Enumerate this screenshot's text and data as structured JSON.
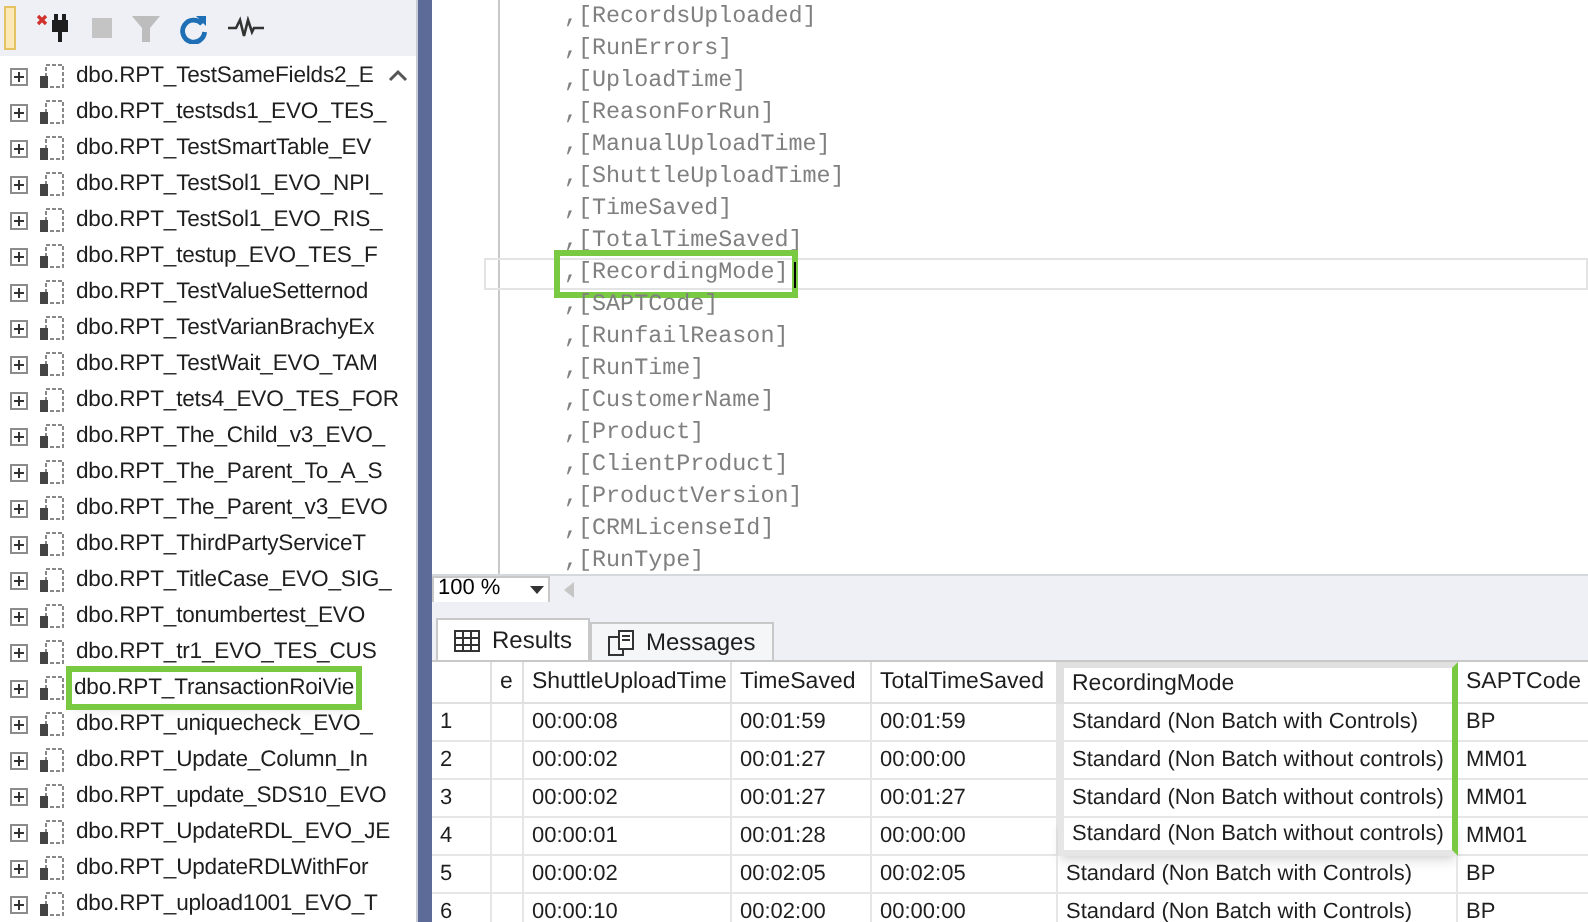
{
  "tree": {
    "items": [
      {
        "label": "dbo.RPT_TestSameFields2_E",
        "highlighted": false
      },
      {
        "label": "dbo.RPT_testsds1_EVO_TES_",
        "highlighted": false
      },
      {
        "label": "dbo.RPT_TestSmartTable_EV",
        "highlighted": false
      },
      {
        "label": "dbo.RPT_TestSol1_EVO_NPI_",
        "highlighted": false
      },
      {
        "label": "dbo.RPT_TestSol1_EVO_RIS_",
        "highlighted": false
      },
      {
        "label": "dbo.RPT_testup_EVO_TES_F",
        "highlighted": false
      },
      {
        "label": "dbo.RPT_TestValueSetternod",
        "highlighted": false
      },
      {
        "label": "dbo.RPT_TestVarianBrachyEx",
        "highlighted": false
      },
      {
        "label": "dbo.RPT_TestWait_EVO_TAM",
        "highlighted": false
      },
      {
        "label": "dbo.RPT_tets4_EVO_TES_FOR",
        "highlighted": false
      },
      {
        "label": "dbo.RPT_The_Child_v3_EVO_",
        "highlighted": false
      },
      {
        "label": "dbo.RPT_The_Parent_To_A_S",
        "highlighted": false
      },
      {
        "label": "dbo.RPT_The_Parent_v3_EVO",
        "highlighted": false
      },
      {
        "label": "dbo.RPT_ThirdPartyServiceT",
        "highlighted": false
      },
      {
        "label": "dbo.RPT_TitleCase_EVO_SIG_",
        "highlighted": false
      },
      {
        "label": "dbo.RPT_tonumbertest_EVO",
        "highlighted": false
      },
      {
        "label": "dbo.RPT_tr1_EVO_TES_CUS",
        "highlighted": false
      },
      {
        "label": "dbo.RPT_TransactionRoiVie",
        "highlighted": true
      },
      {
        "label": "dbo.RPT_uniquecheck_EVO_",
        "highlighted": false
      },
      {
        "label": "dbo.RPT_Update_Column_In",
        "highlighted": false
      },
      {
        "label": "dbo.RPT_update_SDS10_EVO",
        "highlighted": false
      },
      {
        "label": "dbo.RPT_UpdateRDL_EVO_JE",
        "highlighted": false
      },
      {
        "label": "dbo.RPT_UpdateRDLWithFor",
        "highlighted": false
      },
      {
        "label": "dbo.RPT_upload1001_EVO_T",
        "highlighted": false
      }
    ]
  },
  "editor": {
    "lines": [
      {
        "text": ",[RecordsUploaded]",
        "current": false
      },
      {
        "text": ",[RunErrors]",
        "current": false
      },
      {
        "text": ",[UploadTime]",
        "current": false
      },
      {
        "text": ",[ReasonForRun]",
        "current": false
      },
      {
        "text": ",[ManualUploadTime]",
        "current": false
      },
      {
        "text": ",[ShuttleUploadTime]",
        "current": false
      },
      {
        "text": ",[TimeSaved]",
        "current": false
      },
      {
        "text": ",[TotalTimeSaved]",
        "current": false
      },
      {
        "text": ",[RecordingMode]",
        "current": true
      },
      {
        "text": ",[SAPTCode]",
        "current": false
      },
      {
        "text": ",[RunfailReason]",
        "current": false
      },
      {
        "text": ",[RunTime]",
        "current": false
      },
      {
        "text": ",[CustomerName]",
        "current": false
      },
      {
        "text": ",[Product]",
        "current": false
      },
      {
        "text": ",[ClientProduct]",
        "current": false
      },
      {
        "text": ",[ProductVersion]",
        "current": false
      },
      {
        "text": ",[CRMLicenseId]",
        "current": false
      },
      {
        "text": ",[RunType]",
        "current": false
      }
    ],
    "zoom": "100 %"
  },
  "tabs": [
    {
      "label": "Results",
      "selected": true
    },
    {
      "label": "Messages",
      "selected": false
    }
  ],
  "grid": {
    "columns": [
      {
        "highlighted": false
      },
      {
        "label": "e",
        "highlighted": false
      },
      {
        "label": "ShuttleUploadTime",
        "highlighted": false
      },
      {
        "label": "TimeSaved",
        "highlighted": false
      },
      {
        "label": "TotalTimeSaved",
        "highlighted": false
      },
      {
        "label": "RecordingMode",
        "highlighted": true
      },
      {
        "label": "SAPTCode",
        "highlighted": false
      }
    ],
    "rows": [
      [
        "1",
        "",
        "00:00:08",
        "00:01:59",
        "00:01:59",
        "Standard (Non Batch with Controls)",
        "BP"
      ],
      [
        "2",
        "",
        "00:00:02",
        "00:01:27",
        "00:00:00",
        "Standard (Non Batch without controls)",
        "MM01"
      ],
      [
        "3",
        "",
        "00:00:02",
        "00:01:27",
        "00:01:27",
        "Standard (Non Batch without controls)",
        "MM01"
      ],
      [
        "4",
        "",
        "00:00:01",
        "00:01:28",
        "00:00:00",
        "Standard (Non Batch without controls)",
        "MM01"
      ],
      [
        "5",
        "",
        "00:00:02",
        "00:02:05",
        "00:02:05",
        "Standard (Non Batch with Controls)",
        "BP"
      ],
      [
        "6",
        "",
        "00:00:10",
        "00:02:00",
        "00:00:00",
        "Standard (Non Batch with Controls)",
        "BP"
      ]
    ]
  }
}
